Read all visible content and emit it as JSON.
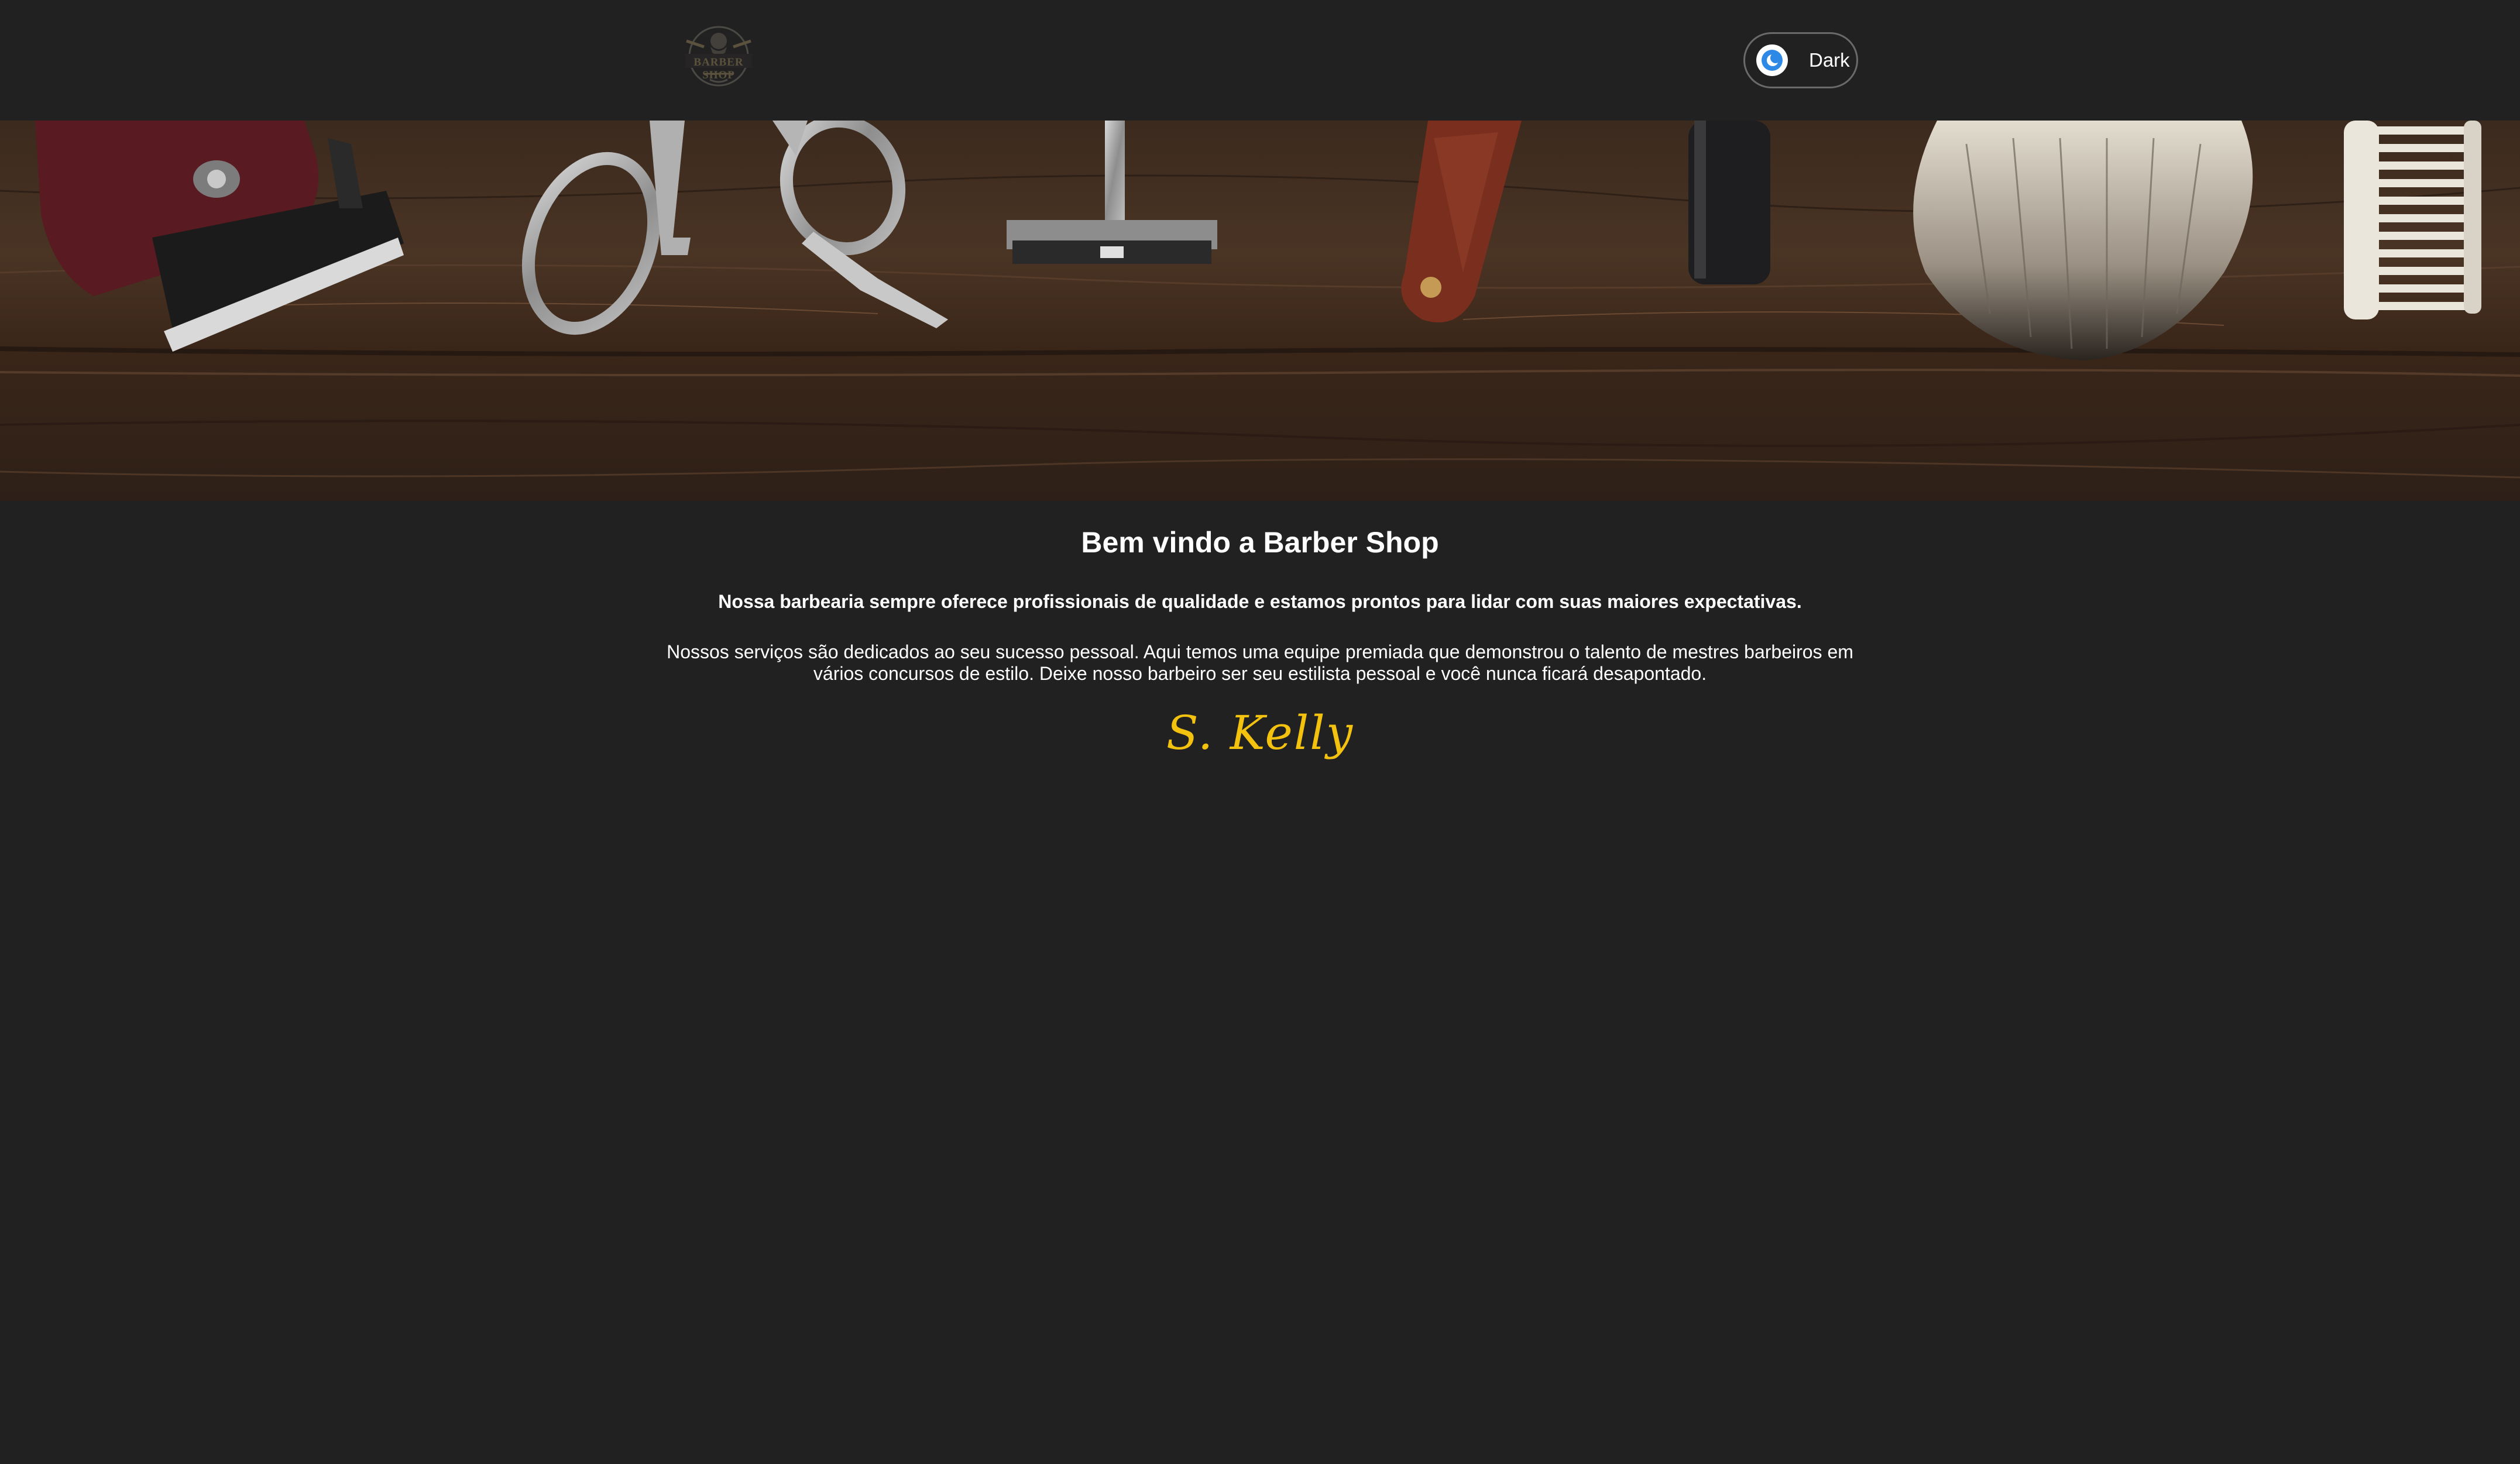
{
  "header": {
    "logo_text": "BARBER SHOP",
    "theme_toggle": {
      "label": "Dark",
      "icon": "moon-icon"
    }
  },
  "banner": {
    "image": "barber-tools-on-wood",
    "tools": [
      "hair-clipper",
      "scissors",
      "safety-razor",
      "straight-razor",
      "shaving-brush",
      "comb"
    ]
  },
  "main": {
    "title": "Bem vindo a Barber Shop",
    "lead": "Nossa barbearia sempre oferece profissionais de qualidade e estamos prontos para lidar com suas maiores expectativas.",
    "body": "Nossos serviços são dedicados ao seu sucesso pessoal. Aqui temos uma equipe premiada que demonstrou o talento de mestres barbeiros em vários concursos de estilo. Deixe nosso barbeiro ser seu estilista pessoal e você nunca ficará desapontado.",
    "signature": "S. Kelly"
  },
  "colors": {
    "background": "#222122",
    "text": "#ffffff",
    "signature": "#f3c20f",
    "toggle_icon": "#2e88e6"
  }
}
